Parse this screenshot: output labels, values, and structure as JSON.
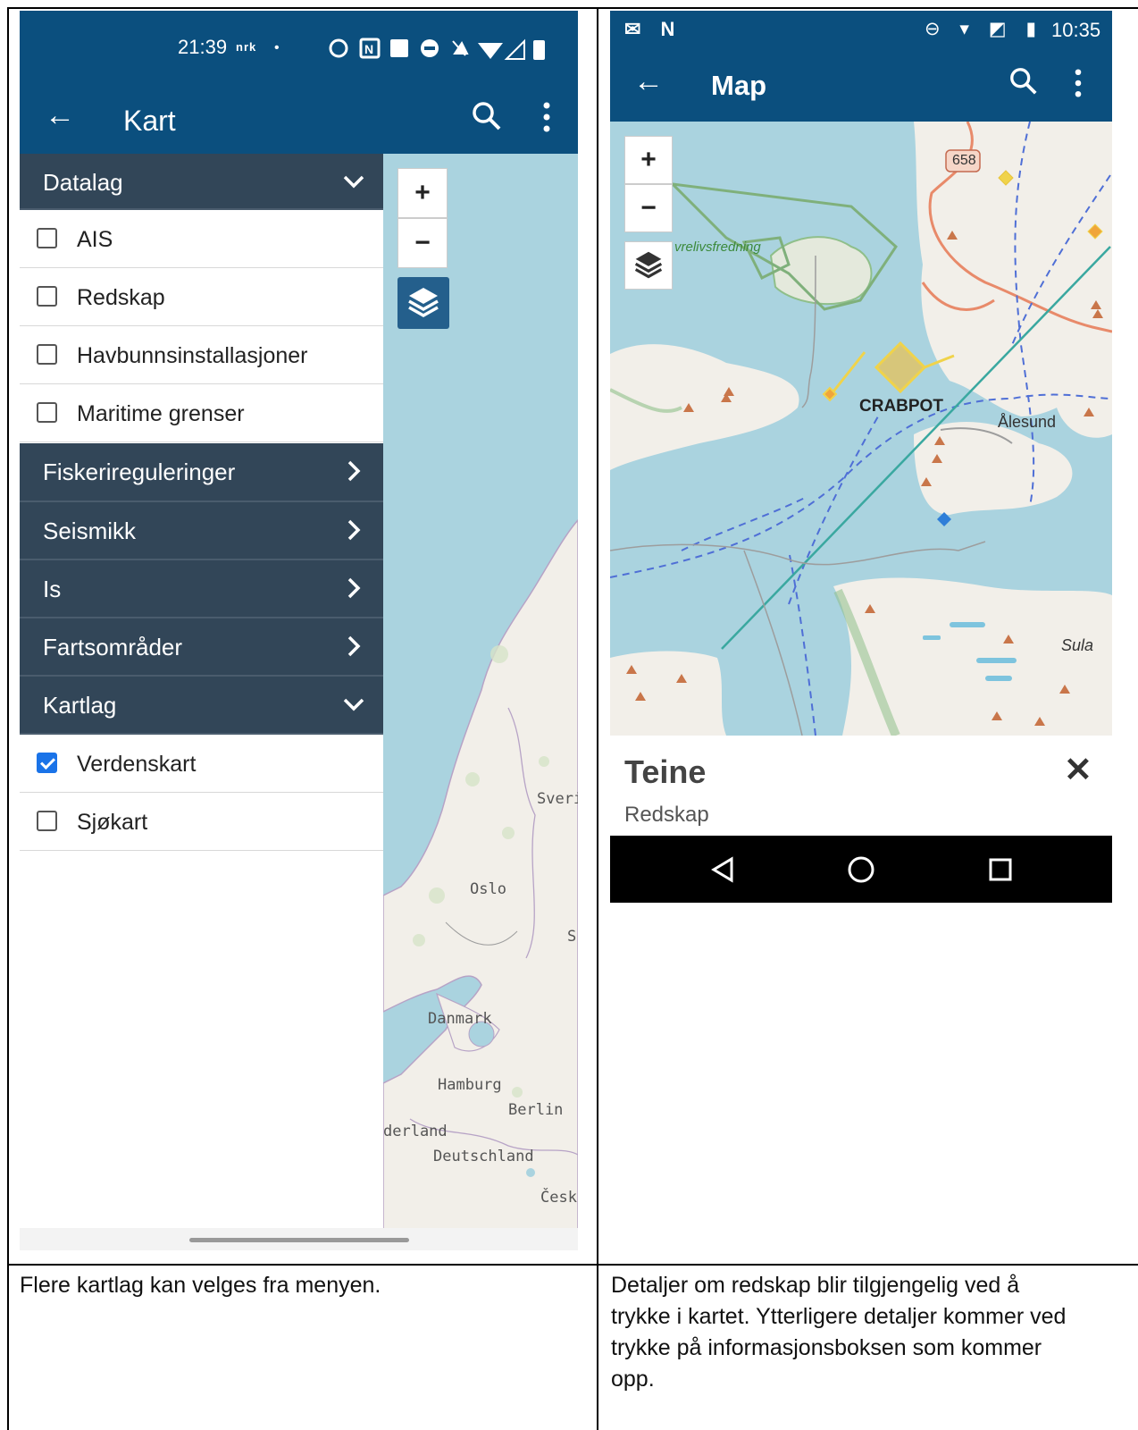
{
  "left": {
    "status": {
      "time": "21:39",
      "nrk": "nrk",
      "dot": "•",
      "icons": "⏰ N ▦ ⊖ 🔕 ▾◢▮"
    },
    "appbar": {
      "title": "Kart",
      "back": "←"
    },
    "drawer": {
      "section_datalag": "Datalag",
      "items_datalag": [
        "AIS",
        "Redskap",
        "Havbunnsinstallasjoner",
        "Maritime grenser"
      ],
      "section_fiskereguleringer": "Fiskerireguleringer",
      "section_seismikk": "Seismikk",
      "section_is": "Is",
      "section_fartsomrader": "Fartsområder",
      "section_kartlag": "Kartlag",
      "item_verdenskart": "Verdenskart",
      "item_sjokart": "Sjøkart"
    },
    "map": {
      "zoom_in": "+",
      "zoom_out": "−",
      "labels": {
        "sverige": "Sveri",
        "oslo": "Oslo",
        "s": "S",
        "danmark": "Danmark",
        "hamburg": "Hamburg",
        "berlin": "Berlin",
        "nederland": "derland",
        "deutschland": "Deutschland",
        "cesk": "Česk"
      }
    }
  },
  "right": {
    "status": {
      "time": "10:35",
      "left_icons": "✉ N",
      "right_icons": "⊖ ▾ ◩ ▮"
    },
    "appbar": {
      "title": "Map",
      "back": "←"
    },
    "map": {
      "zoom_in": "+",
      "zoom_out": "−",
      "road_number": "658",
      "crabpot_label": "CRABPOT",
      "alesund_label": "Ålesund",
      "sula_label": "Sula",
      "reserve_label": "vrelivsfredning"
    },
    "info": {
      "title": "Teine",
      "subtitle": "Redskap",
      "close": "✕"
    }
  },
  "captions": {
    "left": "Flere kartlag kan velges fra menyen.",
    "right_lines": [
      "Detaljer om redskap blir tilgjengelig ved å",
      "trykke i kartet. Ytterligere detaljer kommer ved",
      "trykke på informasjonsboksen som kommer",
      "opp."
    ]
  },
  "colors": {
    "appbar": "#0b4f7e",
    "drawer_section": "#324658",
    "water": "#aad3df",
    "land": "#f2efe9",
    "checkbox": "#1a73e8"
  }
}
